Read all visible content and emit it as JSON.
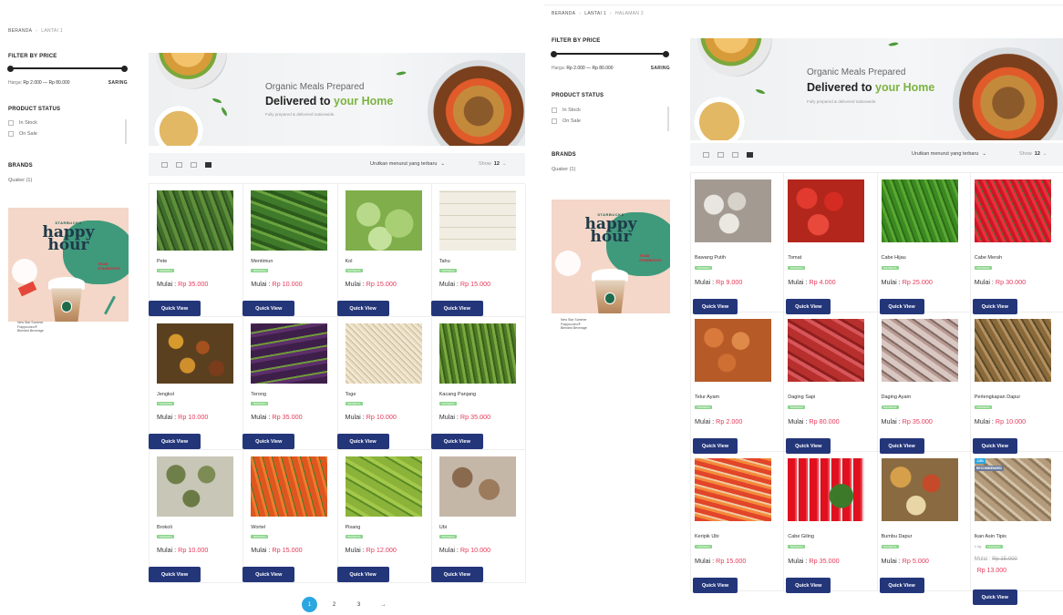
{
  "left": {
    "breadcrumb": [
      "BERANDA",
      "LANTAI 1"
    ],
    "filter_title": "FILTER BY PRICE",
    "price_label": "Harga:",
    "price_range": "Rp 2.000 — Rp 80.000",
    "filter_button": "SARING",
    "status_title": "PRODUCT STATUS",
    "status_options": [
      "In Stock",
      "On Sale"
    ],
    "brands_title": "BRANDS",
    "brand_item": "Quaker (1)",
    "banner": {
      "sub": "Organic Meals Prepared",
      "main_prefix": "Delivered to ",
      "main_highlight": "your Home",
      "fine": "Fully prepared & delivered nationwide."
    },
    "sort_label": "Urutkan menurut yang terbaru",
    "show_label": "Show",
    "show_value": "12",
    "products": [
      {
        "name": "Pete",
        "stock": "TERSEDIA",
        "price_label": "Mulai : ",
        "price": "Rp 35.000",
        "button": "Quick View"
      },
      {
        "name": "Mentimun",
        "stock": "TERSEDIA",
        "price_label": "Mulai : ",
        "price": "Rp 10.000",
        "button": "Quick View"
      },
      {
        "name": "Kol",
        "stock": "TERSEDIA",
        "price_label": "Mulai : ",
        "price": "Rp 15.000",
        "button": "Quick View"
      },
      {
        "name": "Tahu",
        "stock": "TERSEDIA",
        "price_label": "Mulai : ",
        "price": "Rp 15.000",
        "button": "Quick View"
      },
      {
        "name": "Jengkol",
        "stock": "TERSEDIA",
        "price_label": "Mulai : ",
        "price": "Rp 10.000",
        "button": "Quick View"
      },
      {
        "name": "Terong",
        "stock": "TERSEDIA",
        "price_label": "Mulai : ",
        "price": "Rp 35.000",
        "button": "Quick View"
      },
      {
        "name": "Toge",
        "stock": "TERSEDIA",
        "price_label": "Mulai : ",
        "price": "Rp 10.000",
        "button": "Quick View"
      },
      {
        "name": "Kacang Panjang",
        "stock": "TERSEDIA",
        "price_label": "Mulai : ",
        "price": "Rp 35.000",
        "button": "Quick View"
      },
      {
        "name": "Brokoli",
        "stock": "TERSEDIA",
        "price_label": "Mulai : ",
        "price": "Rp 10.000",
        "button": "Quick View"
      },
      {
        "name": "Wortel",
        "stock": "TERSEDIA",
        "price_label": "Mulai : ",
        "price": "Rp 15.000",
        "button": "Quick View"
      },
      {
        "name": "Pisang",
        "stock": "TERSEDIA",
        "price_label": "Mulai : ",
        "price": "Rp 12.000",
        "button": "Quick View"
      },
      {
        "name": "Ubi",
        "stock": "TERSEDIA",
        "price_label": "Mulai : ",
        "price": "Rp 10.000",
        "button": "Quick View"
      }
    ],
    "pagination": [
      "1",
      "2",
      "3",
      "→"
    ]
  },
  "right": {
    "breadcrumb": [
      "BERANDA",
      "LANTAI 1",
      "HALAMAN 2"
    ],
    "filter_title": "FILTER BY PRICE",
    "price_label": "Harga:",
    "price_range": "Rp 2.000 — Rp 80.000",
    "filter_button": "SARING",
    "status_title": "PRODUCT STATUS",
    "status_options": [
      "In Stock",
      "On Sale"
    ],
    "brands_title": "BRANDS",
    "brand_item": "Quaker (1)",
    "banner": {
      "sub": "Organic Meals Prepared",
      "main_prefix": "Delivered to ",
      "main_highlight": "your Home",
      "fine": "Fully prepared & delivered nationwide."
    },
    "sort_label": "Urutkan menurut yang terbaru",
    "show_label": "Show",
    "show_value": "12",
    "products": [
      {
        "name": "Bawang Putih",
        "stock": "TERSEDIA",
        "price_label": "Mulai : ",
        "price": "Rp 9.000",
        "button": "Quick View"
      },
      {
        "name": "Tomat",
        "stock": "TERSEDIA",
        "price_label": "Mulai : ",
        "price": "Rp 4.000",
        "button": "Quick View"
      },
      {
        "name": "Cabe Hijau",
        "stock": "TERSEDIA",
        "price_label": "Mulai : ",
        "price": "Rp 25.000",
        "button": "Quick View"
      },
      {
        "name": "Cabe Merah",
        "stock": "TERSEDIA",
        "price_label": "Mulai : ",
        "price": "Rp 30.000",
        "button": "Quick View"
      },
      {
        "name": "Telur Ayam",
        "stock": "TERSEDIA",
        "price_label": "Mulai : ",
        "price": "Rp 2.000",
        "button": "Quick View"
      },
      {
        "name": "Daging Sapi",
        "stock": "TERSEDIA",
        "price_label": "Mulai : ",
        "price": "Rp 80.000",
        "button": "Quick View"
      },
      {
        "name": "Daging Ayam",
        "stock": "TERSEDIA",
        "price_label": "Mulai : ",
        "price": "Rp 35.000",
        "button": "Quick View"
      },
      {
        "name": "Perlengkapan Dapur",
        "stock": "TERSEDIA",
        "price_label": "Mulai : ",
        "price": "Rp 10.000",
        "button": "Quick View"
      },
      {
        "name": "Keripik Ubi",
        "stock": "TERSEDIA",
        "price_label": "Mulai : ",
        "price": "Rp 15.000",
        "button": "Quick View"
      },
      {
        "name": "Cabe Giling",
        "stock": "TERSEDIA",
        "price_label": "Mulai : ",
        "price": "Rp 35.000",
        "button": "Quick View"
      },
      {
        "name": "Bumbu Dapur",
        "stock": "TERSEDIA",
        "price_label": "Mulai : ",
        "price": "Rp 5.000",
        "button": "Quick View"
      },
      {
        "name": "Ikan Asin Tipis",
        "stock": "TERSEDIA",
        "price_label": "Mulai : ",
        "old_price": "Rp 15.000",
        "price": "Rp 13.000",
        "button": "Quick View",
        "badges": [
          "-13%",
          "RECOMMENDED"
        ],
        "weight": "1 kg"
      }
    ]
  },
  "promo": {
    "brand": "STARBUCKS",
    "title_line1": "happy",
    "title_line2": "hour",
    "team": "TEAM STARBUCKS",
    "caption": "New Star Summer Frappuccino® Blended Beverage"
  },
  "colors": {
    "button": "#24367a",
    "price": "#e53a5a",
    "stock_badge": "#8ad48a",
    "accent": "#7cb342",
    "pager_active": "#2aa7e0",
    "badge_sale": "#2aa7e0",
    "badge_recommended": "#6b7a99"
  },
  "icons": {
    "view_list": "list-view-icon",
    "view_grid2": "grid-2-icon",
    "view_grid3": "grid-3-icon",
    "view_grid4": "grid-4-icon",
    "chevron": "chevron-down-icon",
    "arrow": "arrow-right-icon"
  }
}
